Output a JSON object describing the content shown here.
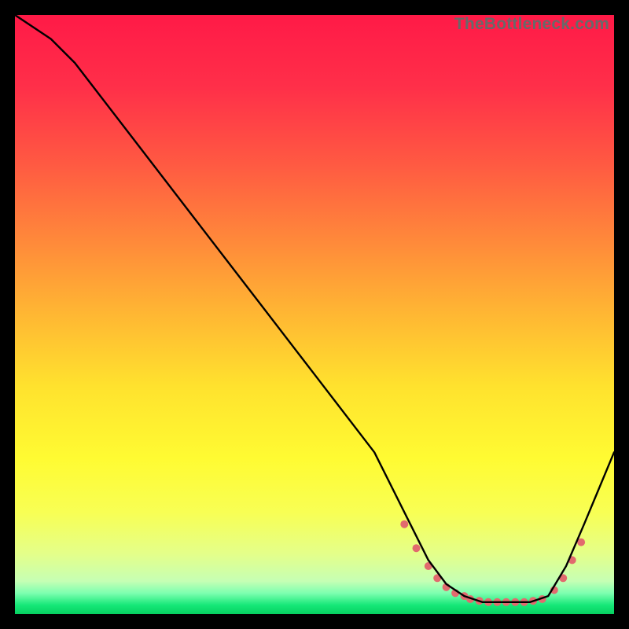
{
  "watermark": "TheBottleneck.com",
  "chart_data": {
    "type": "line",
    "title": "",
    "xlabel": "",
    "ylabel": "",
    "xlim": [
      0,
      100
    ],
    "ylim": [
      0,
      100
    ],
    "background_gradient": {
      "stops": [
        {
          "pos": 0.0,
          "color": "#ff1a47"
        },
        {
          "pos": 0.12,
          "color": "#ff2f49"
        },
        {
          "pos": 0.25,
          "color": "#ff5a42"
        },
        {
          "pos": 0.38,
          "color": "#ff8a3a"
        },
        {
          "pos": 0.5,
          "color": "#ffb733"
        },
        {
          "pos": 0.62,
          "color": "#ffe22e"
        },
        {
          "pos": 0.74,
          "color": "#fffb32"
        },
        {
          "pos": 0.83,
          "color": "#f8ff54"
        },
        {
          "pos": 0.9,
          "color": "#e4ff8a"
        },
        {
          "pos": 0.945,
          "color": "#c6ffb4"
        },
        {
          "pos": 0.965,
          "color": "#7dffb0"
        },
        {
          "pos": 0.985,
          "color": "#16e878"
        },
        {
          "pos": 1.0,
          "color": "#06d060"
        }
      ]
    },
    "series": [
      {
        "name": "bottleneck-curve",
        "color": "#000000",
        "x": [
          0,
          6,
          10,
          20,
          30,
          40,
          50,
          60,
          66,
          69,
          72,
          75,
          78,
          80,
          83,
          86,
          89,
          92,
          95,
          100
        ],
        "y": [
          100,
          96,
          92,
          79,
          66,
          53,
          40,
          27,
          15,
          9,
          5,
          3,
          2,
          2,
          2,
          2,
          3,
          8,
          15,
          27
        ]
      }
    ],
    "markers": {
      "name": "highlight-dots",
      "color": "#e16a6e",
      "x": [
        65,
        67,
        69,
        70.5,
        72,
        73.5,
        75,
        76,
        77.5,
        79,
        80.5,
        82,
        83.5,
        85,
        86.5,
        88,
        90,
        91.5,
        93,
        94.5
      ],
      "y": [
        15,
        11,
        8,
        6,
        4.5,
        3.5,
        3,
        2.5,
        2.2,
        2,
        2,
        2,
        2,
        2,
        2.2,
        2.5,
        4,
        6,
        9,
        12
      ]
    }
  }
}
